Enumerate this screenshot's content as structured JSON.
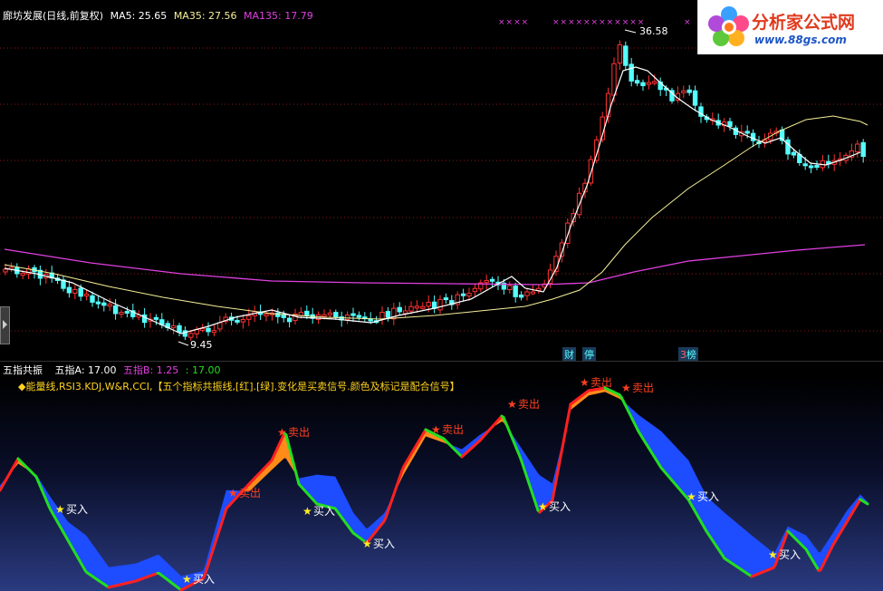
{
  "main": {
    "title": "廊坊发展(日线,前复权)",
    "ma5": "MA5: 25.65",
    "ma35": "MA35: 27.56",
    "ma135": "MA135: 17.79",
    "high_label": "36.58",
    "low_label": "9.45",
    "tag_cai": "财",
    "tag_ting": "停",
    "tag_bang": "榜",
    "tag_bang_prefix": "3",
    "marks_group_1": "××××",
    "marks_group_2": "××××",
    "marks_group_3": "××××××××",
    "marks_group_4": "×"
  },
  "logo": {
    "text": "分析家公式网",
    "url": "www.88gs.com"
  },
  "indicator": {
    "name": "五指共振",
    "a_label": "五指A: 17.00",
    "b_label": "五指B: 1.25",
    "c_label": ": 17.00",
    "description": "◆能量线,RSI3.KDJ,W&R,CCI,【五个指标共振线,[红].[绿].变化是买卖信号.颜色及标记是配合信号】",
    "sell_label": "卖出",
    "buy_label": "买入",
    "sell_signals": 7,
    "buy_signals": 9
  },
  "colors": {
    "up_candle": "#ff3232",
    "down_candle": "#54ffff",
    "ma5": "#ffffff",
    "ma35": "#f5f098",
    "ma135": "#e040e0",
    "grid": "#8a1a1a",
    "orange_fill": "#ff8c1a",
    "blue_fill": "#1e4cff",
    "osc_red": "#ff2020",
    "osc_green": "#22dd22"
  }
}
